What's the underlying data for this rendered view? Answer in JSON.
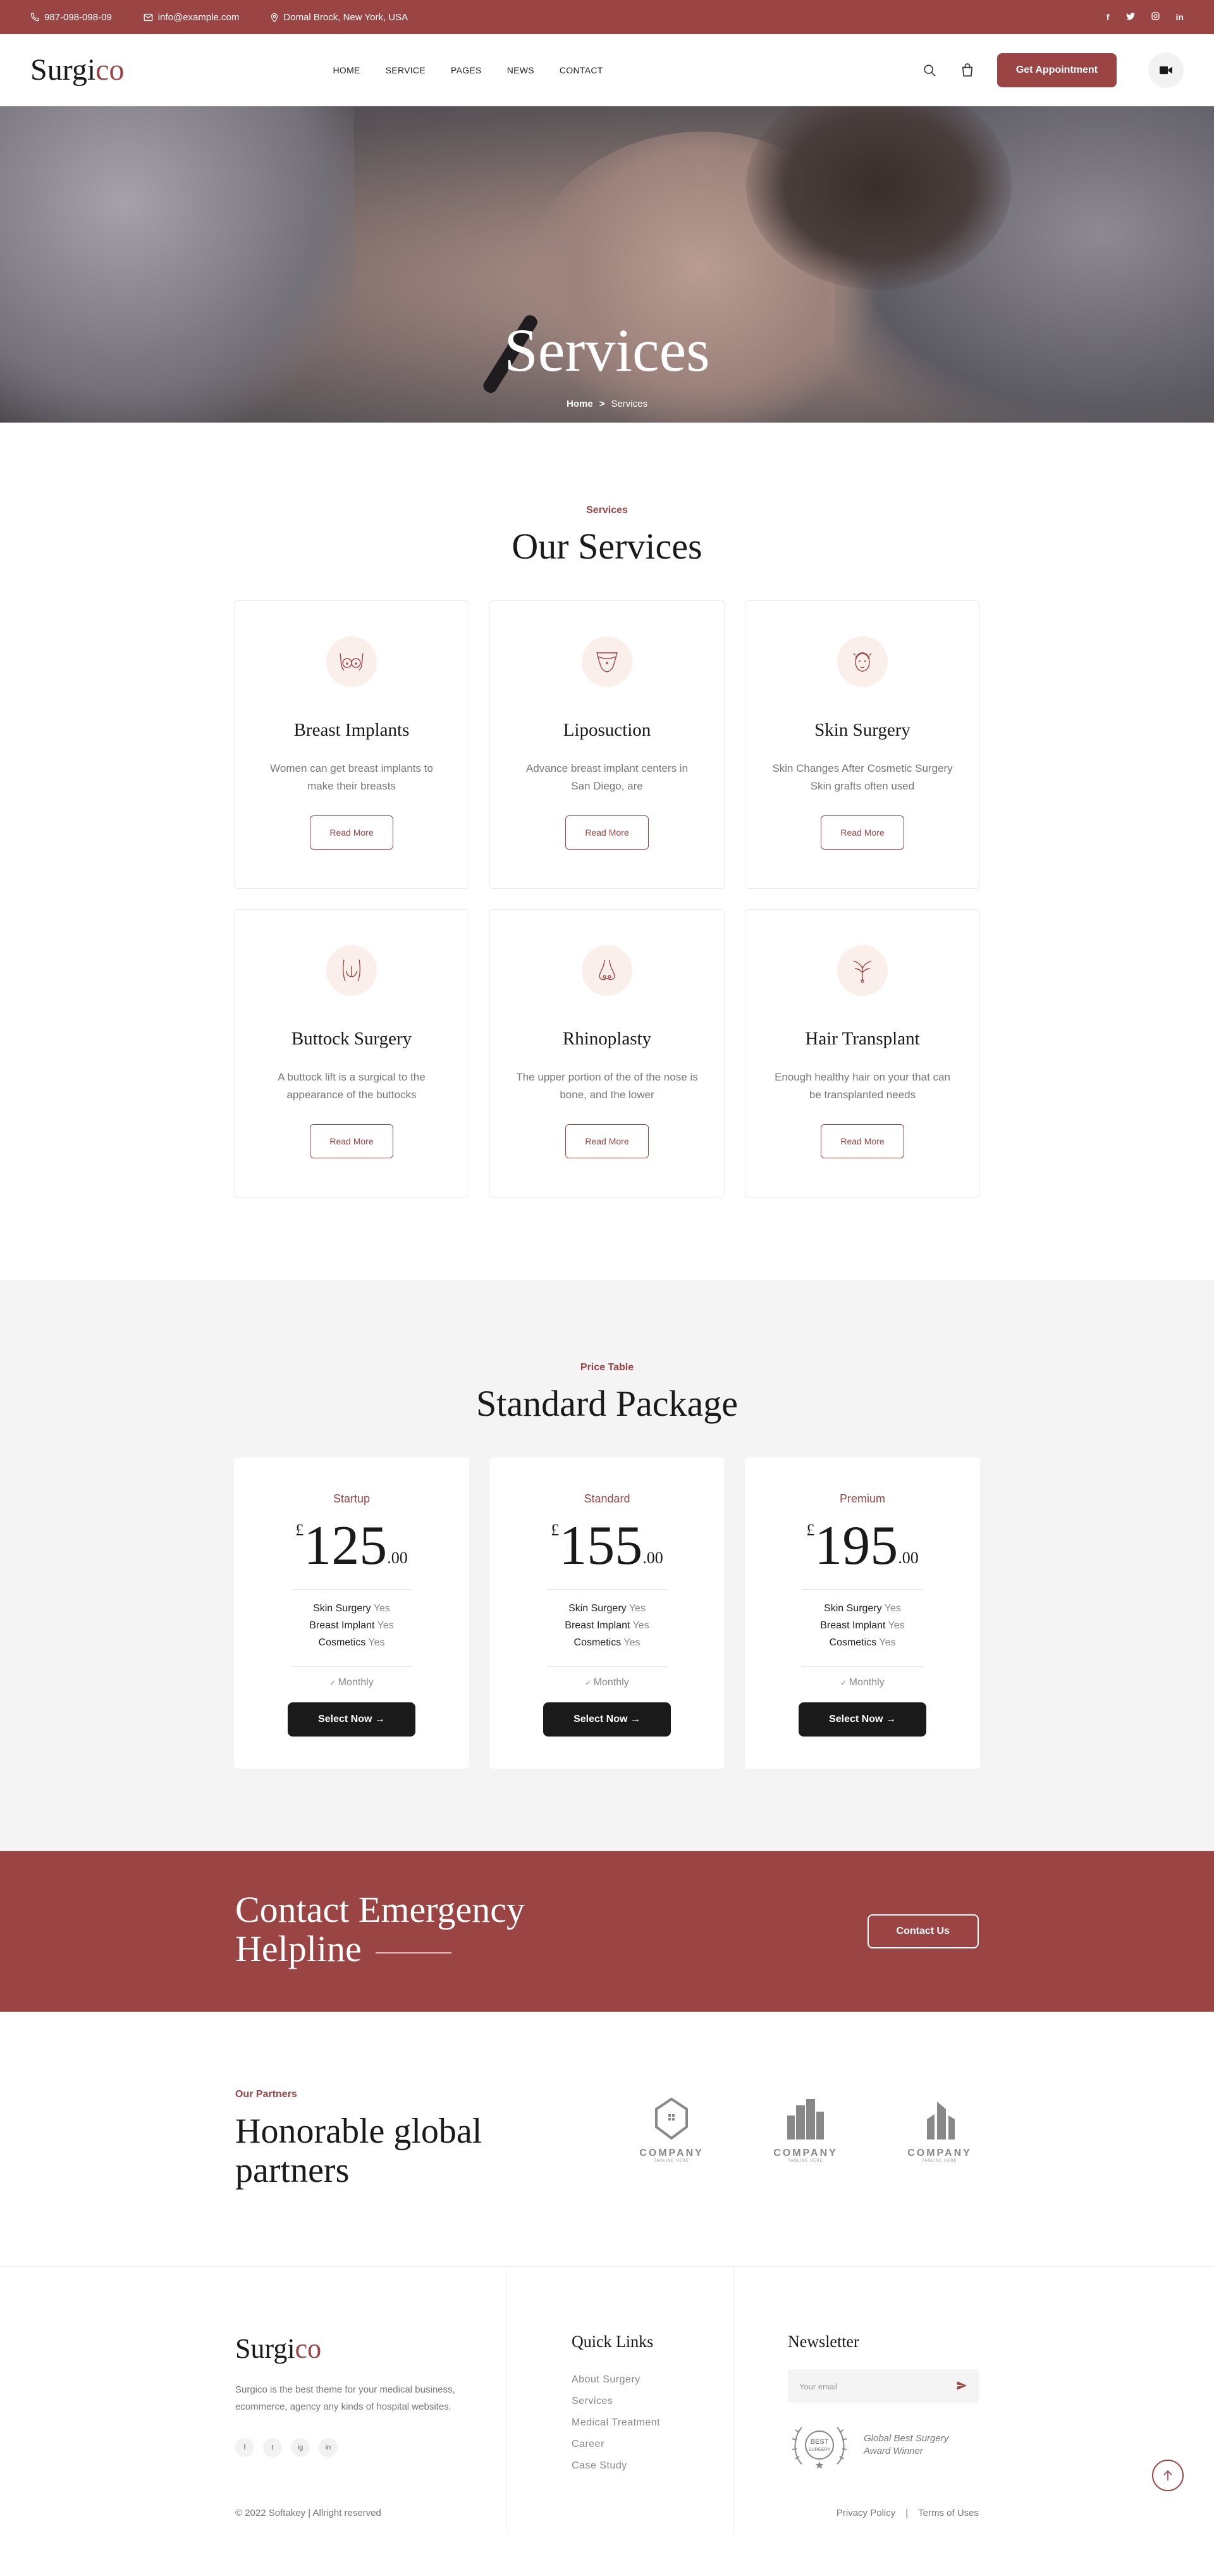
{
  "topbar": {
    "phone": "987-098-098-09",
    "email": "info@example.com",
    "address": "Domal Brock, New York, USA",
    "social": [
      "f",
      "t",
      "ig",
      "in"
    ]
  },
  "header": {
    "logo_main": "Surgi",
    "logo_accent": "co",
    "nav": [
      "HOME",
      "SERVICE",
      "PAGES",
      "NEWS",
      "CONTACT"
    ],
    "appointment": "Get Appointment"
  },
  "hero": {
    "title": "Services",
    "crumb_home": "Home",
    "crumb_sep": ">",
    "crumb_current": "Services"
  },
  "services": {
    "eyebrow": "Services",
    "title": "Our Services",
    "items": [
      {
        "title": "Breast Implants",
        "desc": "Women can get breast implants to make their breasts",
        "cta": "Read More",
        "icon": "breast-icon"
      },
      {
        "title": "Liposuction",
        "desc": "Advance breast implant centers in San Diego, are",
        "cta": "Read More",
        "icon": "liposuction-icon"
      },
      {
        "title": "Skin Surgery",
        "desc": "Skin Changes After Cosmetic Surgery Skin grafts often used",
        "cta": "Read More",
        "icon": "face-icon"
      },
      {
        "title": "Buttock Surgery",
        "desc": "A buttock lift is a surgical to the appearance of the buttocks",
        "cta": "Read More",
        "icon": "buttock-icon"
      },
      {
        "title": "Rhinoplasty",
        "desc": "The upper portion of the of the nose is bone, and the lower",
        "cta": "Read More",
        "icon": "nose-icon"
      },
      {
        "title": "Hair Transplant",
        "desc": "Enough healthy hair on your that can be transplanted needs",
        "cta": "Read More",
        "icon": "hair-icon"
      }
    ]
  },
  "pricing": {
    "eyebrow": "Price Table",
    "title": "Standard Package",
    "plans": [
      {
        "name": "Startup",
        "currency": "£",
        "amount": "125",
        "cents": ".00",
        "features": [
          [
            "Skin Surgery",
            "Yes"
          ],
          [
            "Breast Implant",
            "Yes"
          ],
          [
            "Cosmetics",
            "Yes"
          ]
        ],
        "period": "Monthly",
        "cta": "Select Now →"
      },
      {
        "name": "Standard",
        "currency": "£",
        "amount": "155",
        "cents": ".00",
        "features": [
          [
            "Skin Surgery",
            "Yes"
          ],
          [
            "Breast Implant",
            "Yes"
          ],
          [
            "Cosmetics",
            "Yes"
          ]
        ],
        "period": "Monthly",
        "cta": "Select Now →"
      },
      {
        "name": "Premium",
        "currency": "£",
        "amount": "195",
        "cents": ".00",
        "features": [
          [
            "Skin Surgery",
            "Yes"
          ],
          [
            "Breast Implant",
            "Yes"
          ],
          [
            "Cosmetics",
            "Yes"
          ]
        ],
        "period": "Monthly",
        "cta": "Select Now →"
      }
    ]
  },
  "emergency": {
    "line1": "Contact Emergency",
    "line2": "Helpline",
    "cta": "Contact Us"
  },
  "partners": {
    "eyebrow": "Our Partners",
    "title_line1": "Honorable global",
    "title_line2": "partners",
    "logos": [
      {
        "name": "COMPANY",
        "tag": "TAGLINE HERE"
      },
      {
        "name": "COMPANY",
        "tag": "TAGLINE HERE"
      },
      {
        "name": "COMPANY",
        "tag": "TAGLINE HERE"
      }
    ]
  },
  "footer": {
    "logo_main": "Surgi",
    "logo_accent": "co",
    "desc": "Surgico is the best theme for your medical business, ecommerce, agency any kinds of hospital websites.",
    "social": [
      "f",
      "t",
      "ig",
      "in"
    ],
    "quick_links_title": "Quick Links",
    "links": [
      "About Surgery",
      "Services",
      "Medical Treatment",
      "Career",
      "Case Study"
    ],
    "newsletter_title": "Newsletter",
    "email_placeholder": "Your email",
    "award_badge_top": "BEST",
    "award_badge_bottom": "SURGERY",
    "award_line1": "Global Best Surgery",
    "award_line2": "Award Winner",
    "copyright": "© 2022 Softakey | Allright reserved",
    "privacy": "Privacy Policy",
    "sep": "|",
    "terms": "Terms of Uses"
  },
  "colors": {
    "accent": "#9b4444",
    "dark": "#1a1a1a",
    "light_bg": "#f4f4f4"
  }
}
